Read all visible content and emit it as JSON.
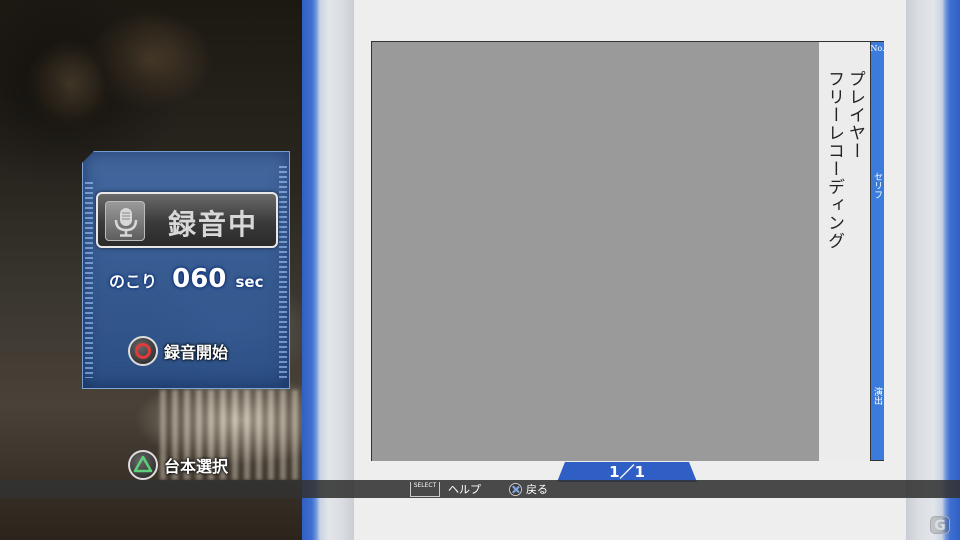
{
  "recording": {
    "status_label": "録音中",
    "remaining_label": "のこり",
    "remaining_value": "060",
    "remaining_unit": "sec",
    "start_label": "録音開始",
    "script_select_label": "台本選択"
  },
  "script": {
    "column_labels": {
      "number": "No.",
      "serif": "セリフ",
      "direction": "演出"
    },
    "lines": [
      "プレイヤー",
      "フリーレコーディング"
    ],
    "page_indicator": "1／1"
  },
  "footer": {
    "select_key": "SELECT",
    "help_label": "ヘルプ",
    "back_label": "戻る"
  },
  "colors": {
    "accent_blue": "#3a7bdc",
    "panel_blue": "#3f6fb0",
    "record_red": "#e23a3a",
    "triangle_green": "#5fd07a"
  },
  "icons": {
    "mic": "microphone-icon",
    "circle": "circle-button-icon",
    "triangle": "triangle-button-icon",
    "cross": "cross-button-icon"
  },
  "logo_mark": "G"
}
